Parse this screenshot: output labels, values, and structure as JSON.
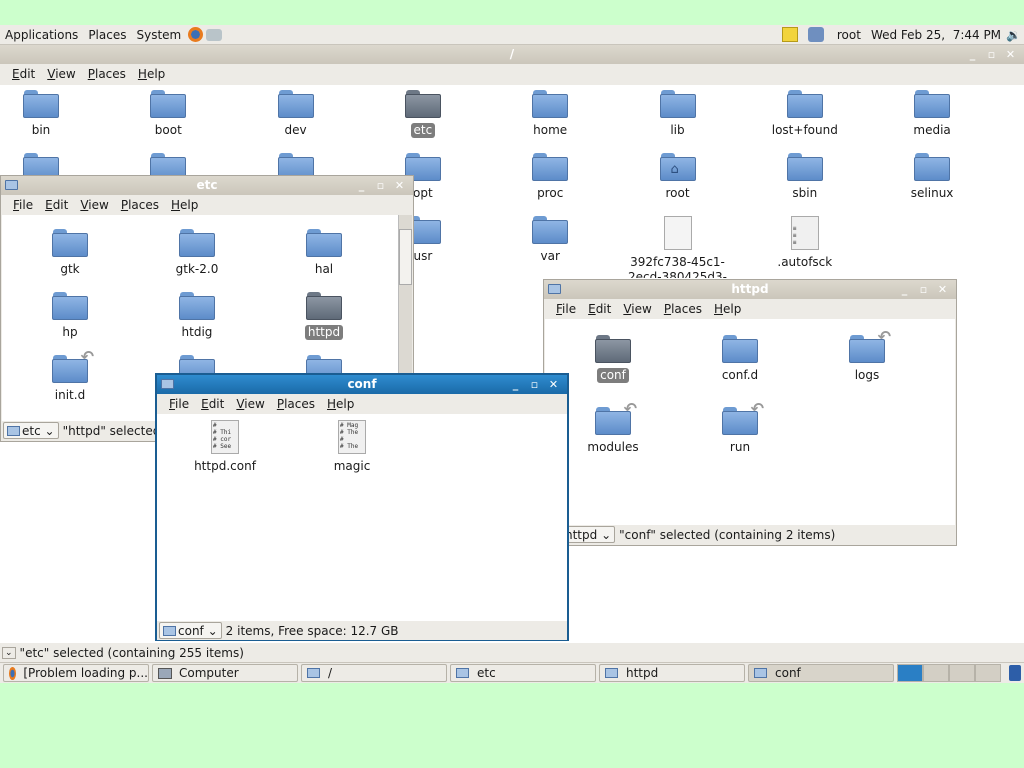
{
  "top_panel": {
    "menus": [
      "Applications",
      "Places",
      "System"
    ],
    "user": "root",
    "clock": "Wed Feb 25,  7:44 PM",
    "icons": [
      "firefox-icon",
      "network-config-icon",
      "notes-icon",
      "network-icon",
      "volume-icon"
    ]
  },
  "root_window": {
    "title": "/",
    "menu": [
      "Edit",
      "View",
      "Places",
      "Help"
    ],
    "status": "\"etc\" selected (containing 255 items)",
    "items": [
      {
        "label": "bin",
        "type": "folder"
      },
      {
        "label": "boot",
        "type": "folder"
      },
      {
        "label": "dev",
        "type": "folder"
      },
      {
        "label": "etc",
        "type": "folder",
        "selected": true
      },
      {
        "label": "home",
        "type": "folder"
      },
      {
        "label": "lib",
        "type": "folder"
      },
      {
        "label": "lost+found",
        "type": "folder"
      },
      {
        "label": "media",
        "type": "folder"
      },
      {
        "label": "",
        "type": "folder"
      },
      {
        "label": "",
        "type": "folder"
      },
      {
        "label": "",
        "type": "folder"
      },
      {
        "label": "opt",
        "type": "folder"
      },
      {
        "label": "proc",
        "type": "folder"
      },
      {
        "label": "root",
        "type": "home"
      },
      {
        "label": "sbin",
        "type": "folder"
      },
      {
        "label": "selinux",
        "type": "folder"
      },
      {
        "label": "",
        "type": "none"
      },
      {
        "label": "",
        "type": "none"
      },
      {
        "label": "",
        "type": "none"
      },
      {
        "label": "usr",
        "type": "folder"
      },
      {
        "label": "var",
        "type": "folder"
      },
      {
        "label": "392fc738-45c1-2ecd-380425d3-",
        "type": "blank"
      },
      {
        "label": ".autofsck",
        "type": "text"
      }
    ]
  },
  "etc_window": {
    "title": "etc",
    "menu": [
      "File",
      "Edit",
      "View",
      "Places",
      "Help"
    ],
    "location": "etc",
    "status": "\"httpd\" selected",
    "items": [
      {
        "label": "gtk",
        "type": "folder"
      },
      {
        "label": "gtk-2.0",
        "type": "folder"
      },
      {
        "label": "hal",
        "type": "folder"
      },
      {
        "label": "hp",
        "type": "folder"
      },
      {
        "label": "htdig",
        "type": "folder"
      },
      {
        "label": "httpd",
        "type": "folder",
        "selected": true
      },
      {
        "label": "init.d",
        "type": "link"
      },
      {
        "label": "",
        "type": "folder"
      },
      {
        "label": "",
        "type": "folder"
      }
    ]
  },
  "httpd_window": {
    "title": "httpd",
    "menu": [
      "File",
      "Edit",
      "View",
      "Places",
      "Help"
    ],
    "location": "httpd",
    "status": "\"conf\" selected (containing 2 items)",
    "items": [
      {
        "label": "conf",
        "type": "folder",
        "selected": true
      },
      {
        "label": "conf.d",
        "type": "folder"
      },
      {
        "label": "logs",
        "type": "link"
      },
      {
        "label": "modules",
        "type": "link"
      },
      {
        "label": "run",
        "type": "link"
      }
    ]
  },
  "conf_window": {
    "title": "conf",
    "menu": [
      "File",
      "Edit",
      "View",
      "Places",
      "Help"
    ],
    "location": "conf",
    "status": "2 items, Free space: 12.7 GB",
    "items": [
      {
        "label": "httpd.conf",
        "type": "text",
        "preview": "#\n# Thi\n# cor\n# See"
      },
      {
        "label": "magic",
        "type": "text",
        "preview": "# Mag\n# The\n#\n# The"
      }
    ]
  },
  "taskbar": {
    "tasks": [
      {
        "label": "[Problem loading p...",
        "icon": "firefox-icon"
      },
      {
        "label": "Computer",
        "icon": "computer-icon"
      },
      {
        "label": "/",
        "icon": "folder-icon"
      },
      {
        "label": "etc",
        "icon": "folder-icon"
      },
      {
        "label": "httpd",
        "icon": "folder-icon"
      },
      {
        "label": "conf",
        "icon": "folder-icon",
        "pressed": true
      }
    ],
    "workspaces": 4,
    "active_workspace": 1
  },
  "colors": {
    "desktop": "#ccffcc",
    "active_title": "#1a6aa8",
    "folder": "#7aa3da"
  }
}
